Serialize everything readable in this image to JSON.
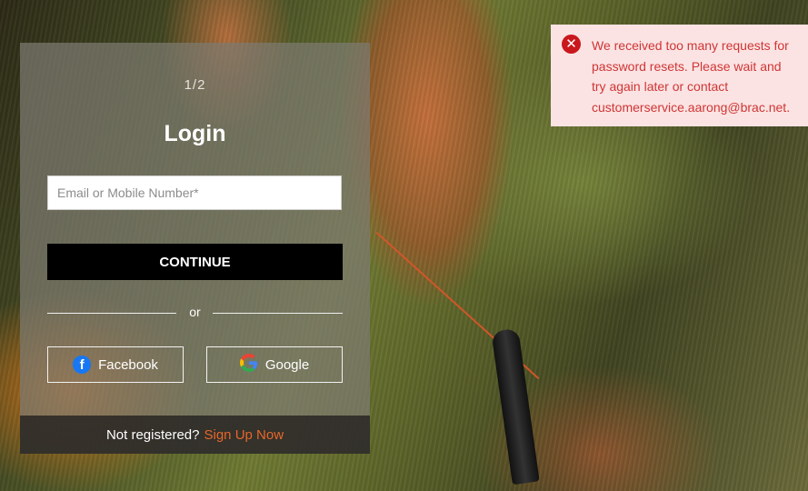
{
  "login": {
    "step": "1/2",
    "title": "Login",
    "email_placeholder": "Email or Mobile Number*",
    "email_value": "",
    "continue_label": "CONTINUE",
    "divider_text": "or",
    "facebook_label": "Facebook",
    "google_label": "Google",
    "footer_question": "Not registered?",
    "signup_label": "Sign Up Now"
  },
  "toast": {
    "message": "We received too many requests for password resets. Please wait and try again later or contact customerservice.aarong@brac.net.",
    "icon": "error-x-icon"
  },
  "colors": {
    "signup_link": "#e8662a",
    "toast_bg": "#fbe3e3",
    "toast_text": "#d03535",
    "continue_bg": "#000000",
    "facebook_blue": "#1877f2"
  },
  "icons": {
    "facebook": "facebook-icon",
    "google": "google-icon"
  }
}
